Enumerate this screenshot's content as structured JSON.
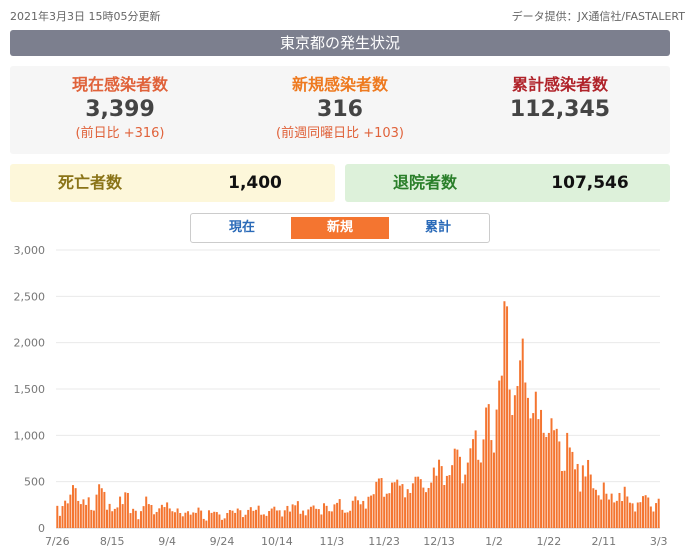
{
  "header": {
    "updated": "2021年3月3日 15時05分更新",
    "source": "データ提供：JX通信社/FASTALERT",
    "title": "東京都の発生状況"
  },
  "stats": {
    "current": {
      "label": "現在感染者数",
      "value": "3,399",
      "sub": "(前日比 +316)"
    },
    "new": {
      "label": "新規感染者数",
      "value": "316",
      "sub": "(前週同曜日比 +103)"
    },
    "total": {
      "label": "累計感染者数",
      "value": "112,345"
    }
  },
  "deaths": {
    "label": "死亡者数",
    "value": "1,400"
  },
  "recovered": {
    "label": "退院者数",
    "value": "107,546"
  },
  "tabs": [
    {
      "label": "現在",
      "active": false
    },
    {
      "label": "新規",
      "active": true
    },
    {
      "label": "累計",
      "active": false
    }
  ],
  "colors": {
    "bar": "#f47530",
    "active_tab": "#f47530",
    "title_bar": "#7c7f8e"
  },
  "chart_data": {
    "type": "bar",
    "ylim": [
      0,
      3000
    ],
    "yticks": [
      "0",
      "500",
      "1,000",
      "1,500",
      "2,000",
      "2,500",
      "3,000"
    ],
    "xtick_labels": [
      "7/26",
      "8/15",
      "9/4",
      "9/24",
      "10/14",
      "11/3",
      "11/23",
      "12/13",
      "1/2",
      "1/22",
      "2/11",
      "3/3"
    ],
    "xlabel": "",
    "ylabel": "",
    "grid": true,
    "series": [
      {
        "values": [
          239,
          131,
          237,
          295,
          266,
          360,
          463,
          430,
          292,
          258,
          309,
          249,
          331,
          195,
          188,
          360,
          472,
          429,
          389,
          197,
          260,
          181,
          206,
          222,
          339,
          258,
          385,
          378,
          161,
          207,
          186,
          95,
          182,
          236,
          339,
          258,
          248,
          148,
          173,
          212,
          250,
          226,
          276,
          211,
          181,
          170,
          211,
          162,
          126,
          165,
          181,
          144,
          168,
          163,
          220,
          188,
          98,
          80,
          191,
          163,
          175,
          172,
          146,
          88,
          104,
          162,
          194,
          187,
          163,
          210,
          192,
          118,
          143,
          195,
          225,
          185,
          196,
          241,
          143,
          147,
          131,
          183,
          210,
          230,
          189,
          191,
          124,
          191,
          238,
          177,
          255,
          245,
          290,
          153,
          188,
          137,
          200,
          229,
          243,
          207,
          204,
          146,
          267,
          239,
          182,
          179,
          255,
          271,
          312,
          196,
          165,
          169,
          186,
          294,
          341,
          299,
          256,
          292,
          209,
          337,
          350,
          365,
          498,
          534,
          539,
          337,
          370,
          376,
          490,
          494,
          522,
          457,
          474,
          331,
          419,
          378,
          482,
          553,
          554,
          527,
          436,
          387,
          432,
          490,
          652,
          564,
          737,
          668,
          464,
          562,
          571,
          678,
          856,
          846,
          768,
          482,
          576,
          706,
          860,
          959,
          1053,
          736,
          707,
          956,
          1300,
          1337,
          949,
          814,
          1278,
          1591,
          1644,
          2447,
          2392,
          1494,
          1219,
          1433,
          1532,
          1809,
          2044,
          1570,
          1404,
          1183,
          1240,
          1471,
          1175,
          1274,
          1027,
          983,
          1026,
          1184,
          1055,
          1070,
          934,
          615,
          618,
          1026,
          869,
          821,
          633,
          691,
          393,
          676,
          556,
          734,
          577,
          429,
          412,
          353,
          307,
          491,
          370,
          307,
          371,
          276,
          293,
          378,
          291,
          445,
          340,
          273,
          266,
          178,
          275,
          279,
          344,
          354,
          329,
          232,
          178,
          269,
          316
        ]
      }
    ]
  }
}
